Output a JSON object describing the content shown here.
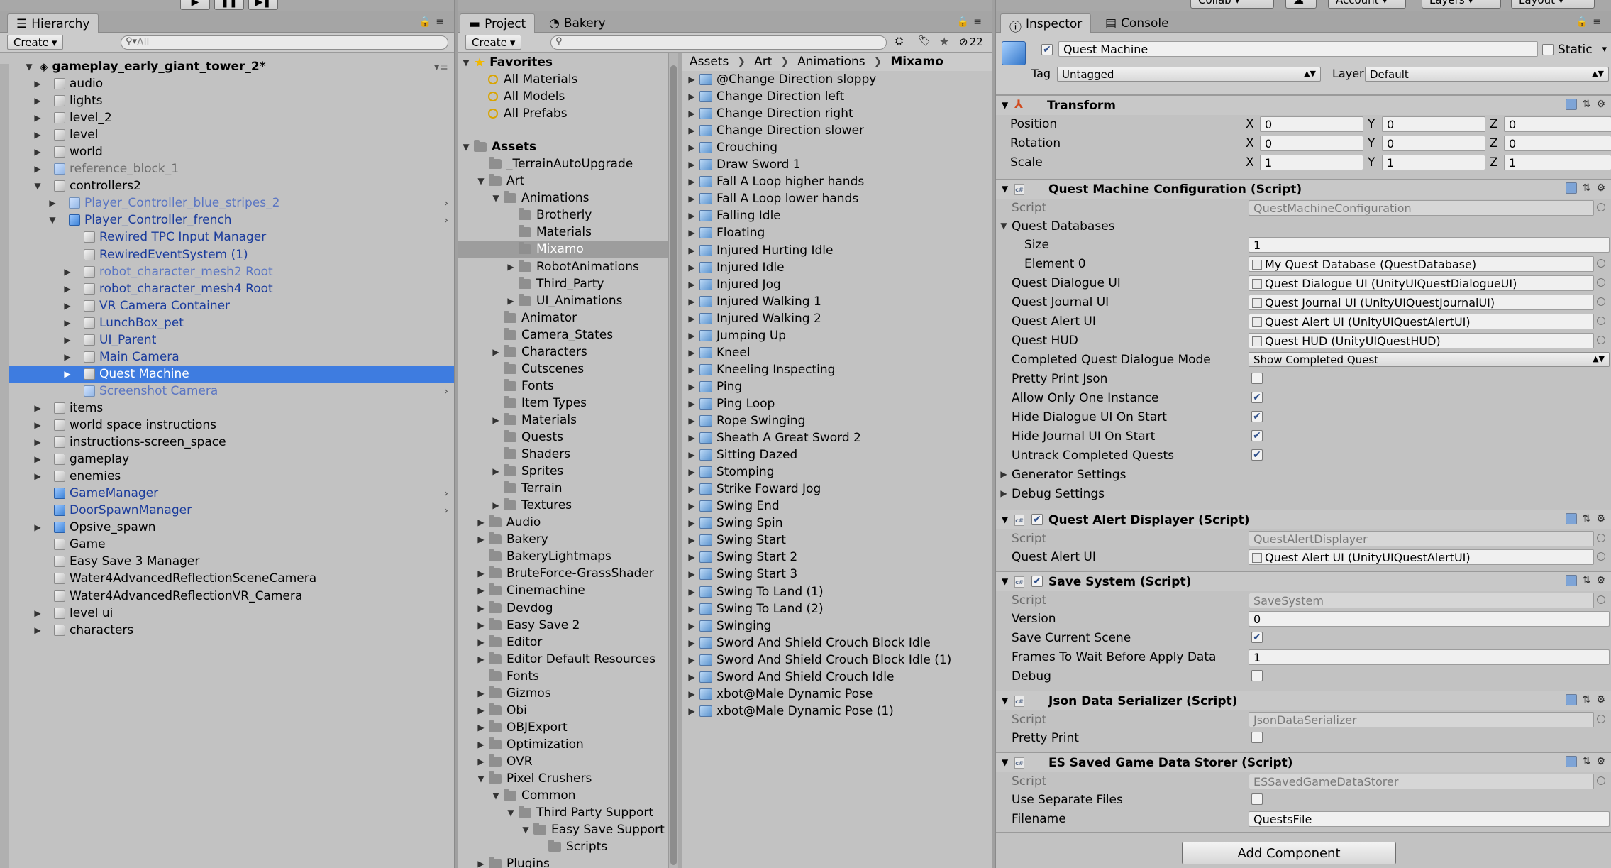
{
  "toolbar": {
    "collab": "Collab",
    "account": "Account",
    "layers": "Layers",
    "layout": "Layout"
  },
  "hierarchy": {
    "tab": "Hierarchy",
    "create": "Create",
    "search_placeholder": "All",
    "scene": "gameplay_early_giant_tower_2*",
    "items": [
      {
        "label": "audio",
        "depth": 1,
        "arrow": "right",
        "icon": "gray",
        "style": ""
      },
      {
        "label": "lights",
        "depth": 1,
        "arrow": "right",
        "icon": "gray",
        "style": ""
      },
      {
        "label": "level_2",
        "depth": 1,
        "arrow": "right",
        "icon": "gray",
        "style": ""
      },
      {
        "label": "level",
        "depth": 1,
        "arrow": "right",
        "icon": "gray",
        "style": ""
      },
      {
        "label": "world",
        "depth": 1,
        "arrow": "right",
        "icon": "gray",
        "style": ""
      },
      {
        "label": "reference_block_1",
        "depth": 1,
        "arrow": "right",
        "icon": "lblue",
        "style": "gray"
      },
      {
        "label": "controllers2",
        "depth": 1,
        "arrow": "down",
        "icon": "gray",
        "style": ""
      },
      {
        "label": "Player_Controller_blue_stripes_2",
        "depth": 2,
        "arrow": "right",
        "icon": "lblue",
        "style": "prefab-l",
        "chev": true
      },
      {
        "label": "Player_Controller_french",
        "depth": 2,
        "arrow": "down",
        "icon": "blue",
        "style": "prefab",
        "chev": true
      },
      {
        "label": "Rewired TPC Input Manager",
        "depth": 3,
        "arrow": "",
        "icon": "gray",
        "style": "prefab"
      },
      {
        "label": "RewiredEventSystem (1)",
        "depth": 3,
        "arrow": "",
        "icon": "gray",
        "style": "prefab"
      },
      {
        "label": "robot_character_mesh2 Root",
        "depth": 3,
        "arrow": "right",
        "icon": "gray",
        "style": "prefab-l"
      },
      {
        "label": "robot_character_mesh4 Root",
        "depth": 3,
        "arrow": "right",
        "icon": "gray",
        "style": "prefab"
      },
      {
        "label": "VR Camera Container",
        "depth": 3,
        "arrow": "right",
        "icon": "gray",
        "style": "prefab"
      },
      {
        "label": "LunchBox_pet",
        "depth": 3,
        "arrow": "right",
        "icon": "gray",
        "style": "prefab"
      },
      {
        "label": "UI_Parent",
        "depth": 3,
        "arrow": "right",
        "icon": "gray",
        "style": "prefab"
      },
      {
        "label": "Main Camera",
        "depth": 3,
        "arrow": "right",
        "icon": "gray",
        "style": "prefab"
      },
      {
        "label": "Quest Machine",
        "depth": 3,
        "arrow": "right",
        "icon": "gray",
        "style": "",
        "selected": true
      },
      {
        "label": "Screenshot Camera",
        "depth": 3,
        "arrow": "",
        "icon": "lblue",
        "style": "prefab-l",
        "chev": true
      },
      {
        "label": "items",
        "depth": 1,
        "arrow": "right",
        "icon": "gray",
        "style": ""
      },
      {
        "label": "world space instructions",
        "depth": 1,
        "arrow": "right",
        "icon": "gray",
        "style": ""
      },
      {
        "label": "instructions-screen_space",
        "depth": 1,
        "arrow": "right",
        "icon": "gray",
        "style": ""
      },
      {
        "label": "gameplay",
        "depth": 1,
        "arrow": "right",
        "icon": "gray",
        "style": ""
      },
      {
        "label": "enemies",
        "depth": 1,
        "arrow": "right",
        "icon": "gray",
        "style": ""
      },
      {
        "label": "GameManager",
        "depth": 1,
        "arrow": "",
        "icon": "blue",
        "style": "prefab",
        "chev": true
      },
      {
        "label": "DoorSpawnManager",
        "depth": 1,
        "arrow": "",
        "icon": "blue",
        "style": "prefab",
        "chev": true
      },
      {
        "label": "Opsive_spawn",
        "depth": 1,
        "arrow": "right",
        "icon": "blue",
        "style": ""
      },
      {
        "label": "Game",
        "depth": 1,
        "arrow": "",
        "icon": "gray",
        "style": ""
      },
      {
        "label": "Easy Save 3 Manager",
        "depth": 1,
        "arrow": "",
        "icon": "gray",
        "style": ""
      },
      {
        "label": "Water4AdvancedReflectionSceneCamera",
        "depth": 1,
        "arrow": "",
        "icon": "gray",
        "style": ""
      },
      {
        "label": "Water4AdvancedReflectionVR_Camera",
        "depth": 1,
        "arrow": "",
        "icon": "gray",
        "style": ""
      },
      {
        "label": "level ui",
        "depth": 1,
        "arrow": "right",
        "icon": "gray",
        "style": ""
      },
      {
        "label": "characters",
        "depth": 1,
        "arrow": "right",
        "icon": "gray",
        "style": ""
      }
    ]
  },
  "project": {
    "tab": "Project",
    "tab2": "Bakery",
    "create": "Create",
    "count": "22",
    "favorites": "Favorites",
    "fav_items": [
      "All Materials",
      "All Models",
      "All Prefabs"
    ],
    "folders": [
      {
        "label": "Assets",
        "depth": 0,
        "arrow": "down",
        "bold": true
      },
      {
        "label": "_TerrainAutoUpgrade",
        "depth": 1,
        "arrow": ""
      },
      {
        "label": "Art",
        "depth": 1,
        "arrow": "down"
      },
      {
        "label": "Animations",
        "depth": 2,
        "arrow": "down"
      },
      {
        "label": "Brotherly",
        "depth": 3,
        "arrow": ""
      },
      {
        "label": "Materials",
        "depth": 3,
        "arrow": ""
      },
      {
        "label": "Mixamo",
        "depth": 3,
        "arrow": "",
        "selected": true
      },
      {
        "label": "RobotAnimations",
        "depth": 3,
        "arrow": "right"
      },
      {
        "label": "Third_Party",
        "depth": 3,
        "arrow": ""
      },
      {
        "label": "UI_Animations",
        "depth": 3,
        "arrow": "right"
      },
      {
        "label": "Animator",
        "depth": 2,
        "arrow": ""
      },
      {
        "label": "Camera_States",
        "depth": 2,
        "arrow": ""
      },
      {
        "label": "Characters",
        "depth": 2,
        "arrow": "right"
      },
      {
        "label": "Cutscenes",
        "depth": 2,
        "arrow": ""
      },
      {
        "label": "Fonts",
        "depth": 2,
        "arrow": ""
      },
      {
        "label": "Item Types",
        "depth": 2,
        "arrow": ""
      },
      {
        "label": "Materials",
        "depth": 2,
        "arrow": "right"
      },
      {
        "label": "Quests",
        "depth": 2,
        "arrow": ""
      },
      {
        "label": "Shaders",
        "depth": 2,
        "arrow": ""
      },
      {
        "label": "Sprites",
        "depth": 2,
        "arrow": "right"
      },
      {
        "label": "Terrain",
        "depth": 2,
        "arrow": ""
      },
      {
        "label": "Textures",
        "depth": 2,
        "arrow": "right"
      },
      {
        "label": "Audio",
        "depth": 1,
        "arrow": "right"
      },
      {
        "label": "Bakery",
        "depth": 1,
        "arrow": "right"
      },
      {
        "label": "BakeryLightmaps",
        "depth": 1,
        "arrow": ""
      },
      {
        "label": "BruteForce-GrassShader",
        "depth": 1,
        "arrow": "right"
      },
      {
        "label": "Cinemachine",
        "depth": 1,
        "arrow": "right"
      },
      {
        "label": "Devdog",
        "depth": 1,
        "arrow": "right"
      },
      {
        "label": "Easy Save 2",
        "depth": 1,
        "arrow": "right"
      },
      {
        "label": "Editor",
        "depth": 1,
        "arrow": "right"
      },
      {
        "label": "Editor Default Resources",
        "depth": 1,
        "arrow": "right"
      },
      {
        "label": "Fonts",
        "depth": 1,
        "arrow": ""
      },
      {
        "label": "Gizmos",
        "depth": 1,
        "arrow": "right"
      },
      {
        "label": "Obi",
        "depth": 1,
        "arrow": "right"
      },
      {
        "label": "OBJExport",
        "depth": 1,
        "arrow": "right"
      },
      {
        "label": "Optimization",
        "depth": 1,
        "arrow": "right"
      },
      {
        "label": "OVR",
        "depth": 1,
        "arrow": "right"
      },
      {
        "label": "Pixel Crushers",
        "depth": 1,
        "arrow": "down"
      },
      {
        "label": "Common",
        "depth": 2,
        "arrow": "down"
      },
      {
        "label": "Third Party Support",
        "depth": 3,
        "arrow": "down"
      },
      {
        "label": "Easy Save Support",
        "depth": 4,
        "arrow": "down"
      },
      {
        "label": "Scripts",
        "depth": 5,
        "arrow": ""
      },
      {
        "label": "Plugins",
        "depth": 1,
        "arrow": "right"
      }
    ],
    "breadcrumb": [
      "Assets",
      "Art",
      "Animations",
      "Mixamo"
    ],
    "files": [
      "@Change Direction sloppy",
      "Change Direction left",
      "Change Direction right",
      "Change Direction slower",
      "Crouching",
      "Draw Sword 1",
      "Fall A Loop higher hands",
      "Fall A Loop lower hands",
      "Falling Idle",
      "Floating",
      "Injured Hurting Idle",
      "Injured Idle",
      "Injured Jog",
      "Injured Walking 1",
      "Injured Walking 2",
      "Jumping Up",
      "Kneel",
      "Kneeling Inspecting",
      "Ping",
      "Ping Loop",
      "Rope Swinging",
      "Sheath A Great Sword 2",
      "Sitting Dazed",
      "Stomping",
      "Strike Foward Jog",
      "Swing End",
      "Swing Spin",
      "Swing Start",
      "Swing Start 2",
      "Swing Start 3",
      "Swing To Land (1)",
      "Swing To Land (2)",
      "Swinging",
      "Sword And Shield Crouch Block Idle",
      "Sword And Shield Crouch Block Idle (1)",
      "Sword And Shield Crouch Idle",
      "xbot@Male Dynamic Pose",
      "xbot@Male Dynamic Pose (1)"
    ]
  },
  "inspector": {
    "tab": "Inspector",
    "tab2": "Console",
    "object_name": "Quest Machine",
    "static_label": "Static",
    "tag_label": "Tag",
    "tag_value": "Untagged",
    "layer_label": "Layer",
    "layer_value": "Default",
    "transform": {
      "title": "Transform",
      "position": "Position",
      "rotation": "Rotation",
      "scale": "Scale",
      "pos": [
        "0",
        "0",
        "0"
      ],
      "rot": [
        "0",
        "0",
        "0"
      ],
      "scl": [
        "1",
        "1",
        "1"
      ],
      "axes": [
        "X",
        "Y",
        "Z"
      ]
    },
    "qmc": {
      "title": "Quest Machine Configuration (Script)",
      "script_label": "Script",
      "script_value": "QuestMachineConfiguration",
      "databases": "Quest Databases",
      "size_label": "Size",
      "size_value": "1",
      "element0_label": "Element 0",
      "element0_value": "My Quest Database (QuestDatabase)",
      "dialogue_label": "Quest Dialogue UI",
      "dialogue_value": "Quest Dialogue UI (UnityUIQuestDialogueUI)",
      "journal_label": "Quest Journal UI",
      "journal_value": "Quest Journal UI (UnityUIQuestJournalUI)",
      "alert_label": "Quest Alert UI",
      "alert_value": "Quest Alert UI (UnityUIQuestAlertUI)",
      "hud_label": "Quest HUD",
      "hud_value": "Quest HUD (UnityUIQuestHUD)",
      "mode_label": "Completed Quest Dialogue Mode",
      "mode_value": "Show Completed Quest",
      "pretty_label": "Pretty Print Json",
      "allow_label": "Allow Only One Instance",
      "hide_dialogue_label": "Hide Dialogue UI On Start",
      "hide_journal_label": "Hide Journal UI On Start",
      "untrack_label": "Untrack Completed Quests",
      "generator": "Generator Settings",
      "debug": "Debug Settings"
    },
    "qad": {
      "title": "Quest Alert Displayer (Script)",
      "script_label": "Script",
      "script_value": "QuestAlertDisplayer",
      "alert_label": "Quest Alert UI",
      "alert_value": "Quest Alert UI (UnityUIQuestAlertUI)"
    },
    "ss": {
      "title": "Save System (Script)",
      "script_label": "Script",
      "script_value": "SaveSystem",
      "version_label": "Version",
      "version_value": "0",
      "save_scene_label": "Save Current Scene",
      "frames_label": "Frames To Wait Before Apply Data",
      "frames_value": "1",
      "debug_label": "Debug"
    },
    "jds": {
      "title": "Json Data Serializer (Script)",
      "script_label": "Script",
      "script_value": "JsonDataSerializer",
      "pretty_label": "Pretty Print"
    },
    "es": {
      "title": "ES Saved Game Data Storer (Script)",
      "script_label": "Script",
      "script_value": "ESSavedGameDataStorer",
      "separate_label": "Use Separate Files",
      "filename_label": "Filename",
      "filename_value": "QuestsFile"
    },
    "add_component": "Add Component"
  }
}
